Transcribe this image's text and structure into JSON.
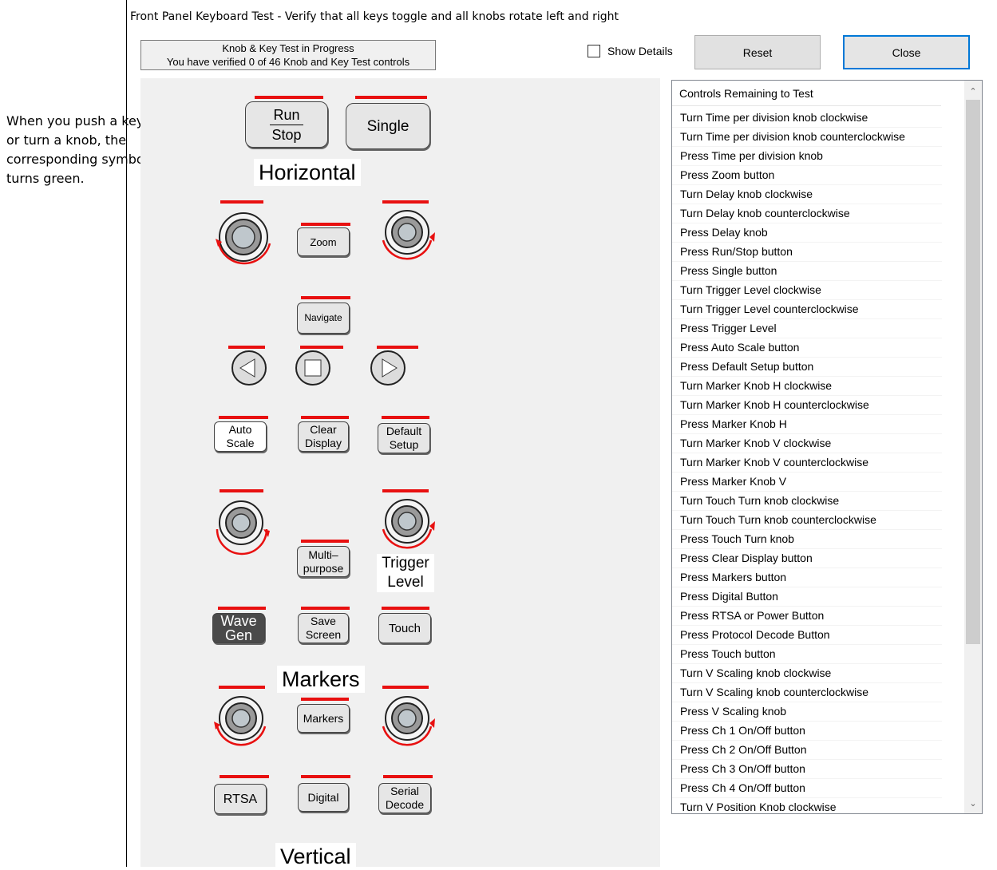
{
  "callout": {
    "lines": [
      "When you push a key",
      "or turn a knob, the",
      "corresponding symbol",
      "turns green."
    ]
  },
  "window": {
    "title": "Front Panel Keyboard Test  - Verify that all keys toggle and all knobs rotate left and right"
  },
  "status": {
    "line1": "Knob & Key Test in Progress",
    "line2": "You have verified 0 of 46 Knob and Key Test controls"
  },
  "controls": {
    "show_details_label": "Show Details",
    "show_details_checked": false,
    "reset_label": "Reset",
    "close_label": "Close"
  },
  "panel": {
    "sections": {
      "horizontal": "Horizontal",
      "trigger_level": [
        "Trigger",
        "Level"
      ],
      "markers": "Markers",
      "vertical": "Vertical"
    },
    "keys": {
      "run_stop": [
        "Run",
        "Stop"
      ],
      "single": "Single",
      "zoom": "Zoom",
      "navigate": "Navigate",
      "auto_scale": [
        "Auto",
        "Scale"
      ],
      "clear_display": [
        "Clear",
        "Display"
      ],
      "default_setup": [
        "Default",
        "Setup"
      ],
      "multipurpose": [
        "Multi–",
        "purpose"
      ],
      "wave_gen": [
        "Wave",
        "Gen"
      ],
      "save_screen": [
        "Save",
        "Screen"
      ],
      "touch": "Touch",
      "markers": "Markers",
      "rtsa": "RTSA",
      "digital": "Digital",
      "serial_decode": [
        "Serial",
        "Decode"
      ]
    },
    "indicator_color": "#e81010",
    "key_color": "#e6e6e6",
    "panel_color": "#f0f0f0"
  },
  "list": {
    "header": "Controls Remaining to Test",
    "items": [
      "Turn Time per division knob clockwise",
      "Turn Time per division knob counterclockwise",
      "Press Time per division knob",
      "Press Zoom button",
      "Turn Delay knob clockwise",
      "Turn Delay knob counterclockwise",
      "Press Delay knob",
      "Press Run/Stop button",
      "Press Single button",
      "Turn Trigger Level clockwise",
      "Turn Trigger Level counterclockwise",
      "Press Trigger Level",
      "Press Auto Scale button",
      "Press Default Setup button",
      "Turn Marker Knob H clockwise",
      "Turn Marker Knob H counterclockwise",
      "Press Marker Knob H",
      "Turn Marker Knob V clockwise",
      "Turn Marker Knob V counterclockwise",
      "Press Marker Knob V",
      "Turn Touch Turn knob clockwise",
      "Turn Touch Turn knob counterclockwise",
      "Press Touch Turn knob",
      "Press Clear Display button",
      "Press Markers button",
      "Press Digital Button",
      "Press RTSA or Power Button",
      "Press Protocol Decode Button",
      "Press Touch button",
      "Turn V Scaling knob clockwise",
      "Turn V Scaling knob counterclockwise",
      "Press V Scaling knob",
      "Press Ch 1 On/Off button",
      "Press Ch 2 On/Off Button",
      "Press Ch 3 On/Off button",
      "Press Ch 4 On/Off button",
      "Turn V Position Knob clockwise"
    ]
  }
}
